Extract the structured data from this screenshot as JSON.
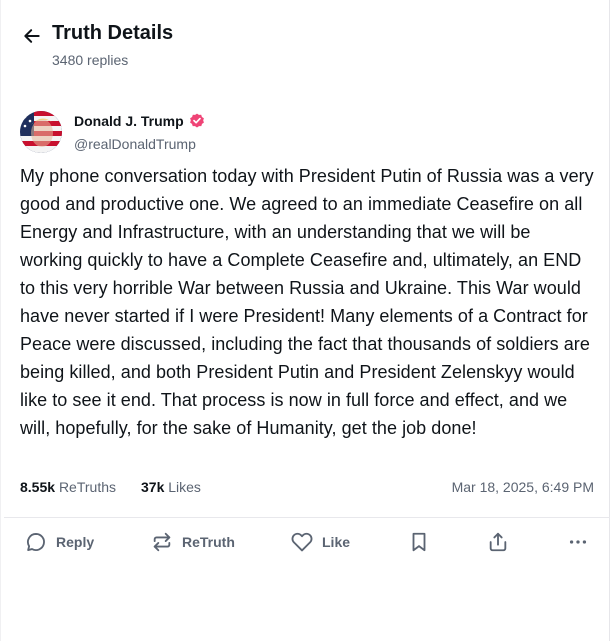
{
  "header": {
    "back_icon": "arrow-left-icon",
    "title": "Truth Details",
    "replies": "3480 replies"
  },
  "post": {
    "author": {
      "name": "Donald J. Trump",
      "handle": "@realDonaldTrump",
      "verified_icon": "verified-badge-icon",
      "verified_color": "#ef4476"
    },
    "text": "My phone conversation today with President Putin of Russia was a very good and productive one. We agreed to an immediate Ceasefire on all Energy and Infrastructure, with an understanding that we will be working quickly to have a Complete Ceasefire and, ultimately, an END to this very horrible War between Russia and Ukraine. This War would have never started if I were President! Many elements of a Contract for Peace were discussed, including the fact that thousands of soldiers are being killed, and both President Putin and President Zelenskyy would like to see it end. That process is now in full force and effect, and we will, hopefully, for the sake of Humanity, get the job done!",
    "stats": {
      "retruths_count": "8.55k",
      "retruths_label": "ReTruths",
      "likes_count": "37k",
      "likes_label": "Likes"
    },
    "timestamp": "Mar 18, 2025, 6:49 PM"
  },
  "actions": {
    "reply": "Reply",
    "retruth": "ReTruth",
    "like": "Like",
    "bookmark_icon": "bookmark-icon",
    "share_icon": "share-icon",
    "more_icon": "more-horizontal-icon"
  },
  "colors": {
    "text": "#0f1419",
    "muted": "#5b6472",
    "divider": "#e8e8ec"
  }
}
